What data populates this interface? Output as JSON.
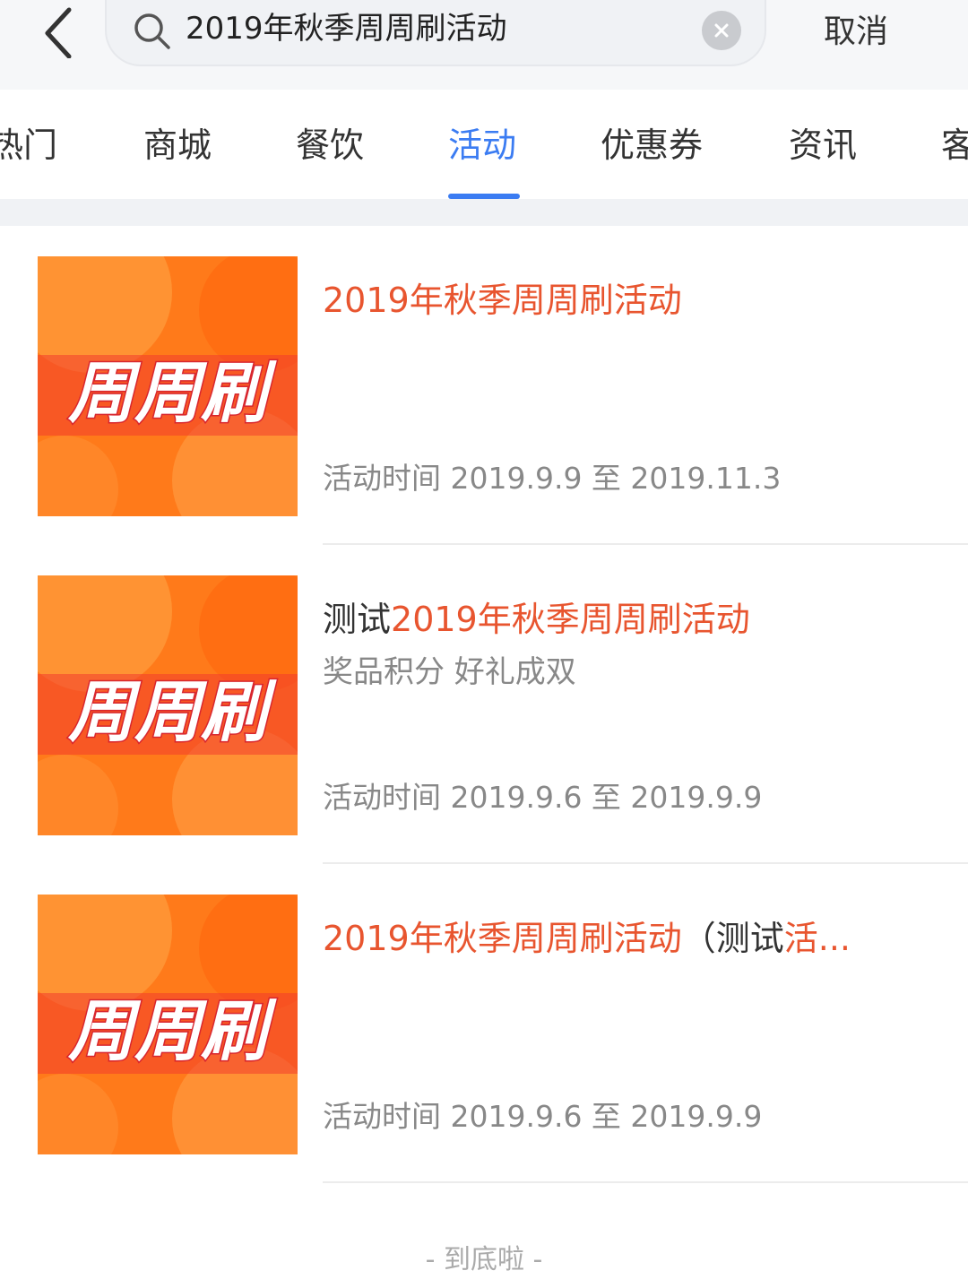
{
  "search": {
    "query": "2019年秋季周周刷活动",
    "cancel_label": "取消"
  },
  "tabs": [
    {
      "label": "热门"
    },
    {
      "label": "商城"
    },
    {
      "label": "餐饮"
    },
    {
      "label": "活动",
      "active": true
    },
    {
      "label": "优惠券"
    },
    {
      "label": "资讯"
    },
    {
      "label": "客"
    }
  ],
  "results": [
    {
      "title_prefix": "",
      "title_highlight": "2019年秋季周周刷活动",
      "title_suffix": "",
      "title_tail": "",
      "subtitle": "",
      "time": "活动时间  2019.9.9 至 2019.11.3",
      "thumb_text": "周周刷"
    },
    {
      "title_prefix": "测试",
      "title_highlight": "2019年秋季周周刷活动",
      "title_suffix": "",
      "title_tail": "",
      "subtitle": "奖品积分  好礼成双",
      "time": "活动时间  2019.9.6 至 2019.9.9",
      "thumb_text": "周周刷"
    },
    {
      "title_prefix": "",
      "title_highlight": "2019年秋季周周刷活动",
      "title_suffix": "（测试",
      "title_tail": "活...",
      "subtitle": "",
      "time": "活动时间  2019.9.6 至 2019.9.9",
      "thumb_text": "周周刷"
    }
  ],
  "end_text": "- 到底啦 -",
  "colors": {
    "accent": "#3b7cf2",
    "highlight": "#e8552f",
    "thumb_orange": "#ff7a1a"
  },
  "icons": {
    "back": "chevron-left-icon",
    "search": "search-icon",
    "clear": "clear-icon"
  }
}
